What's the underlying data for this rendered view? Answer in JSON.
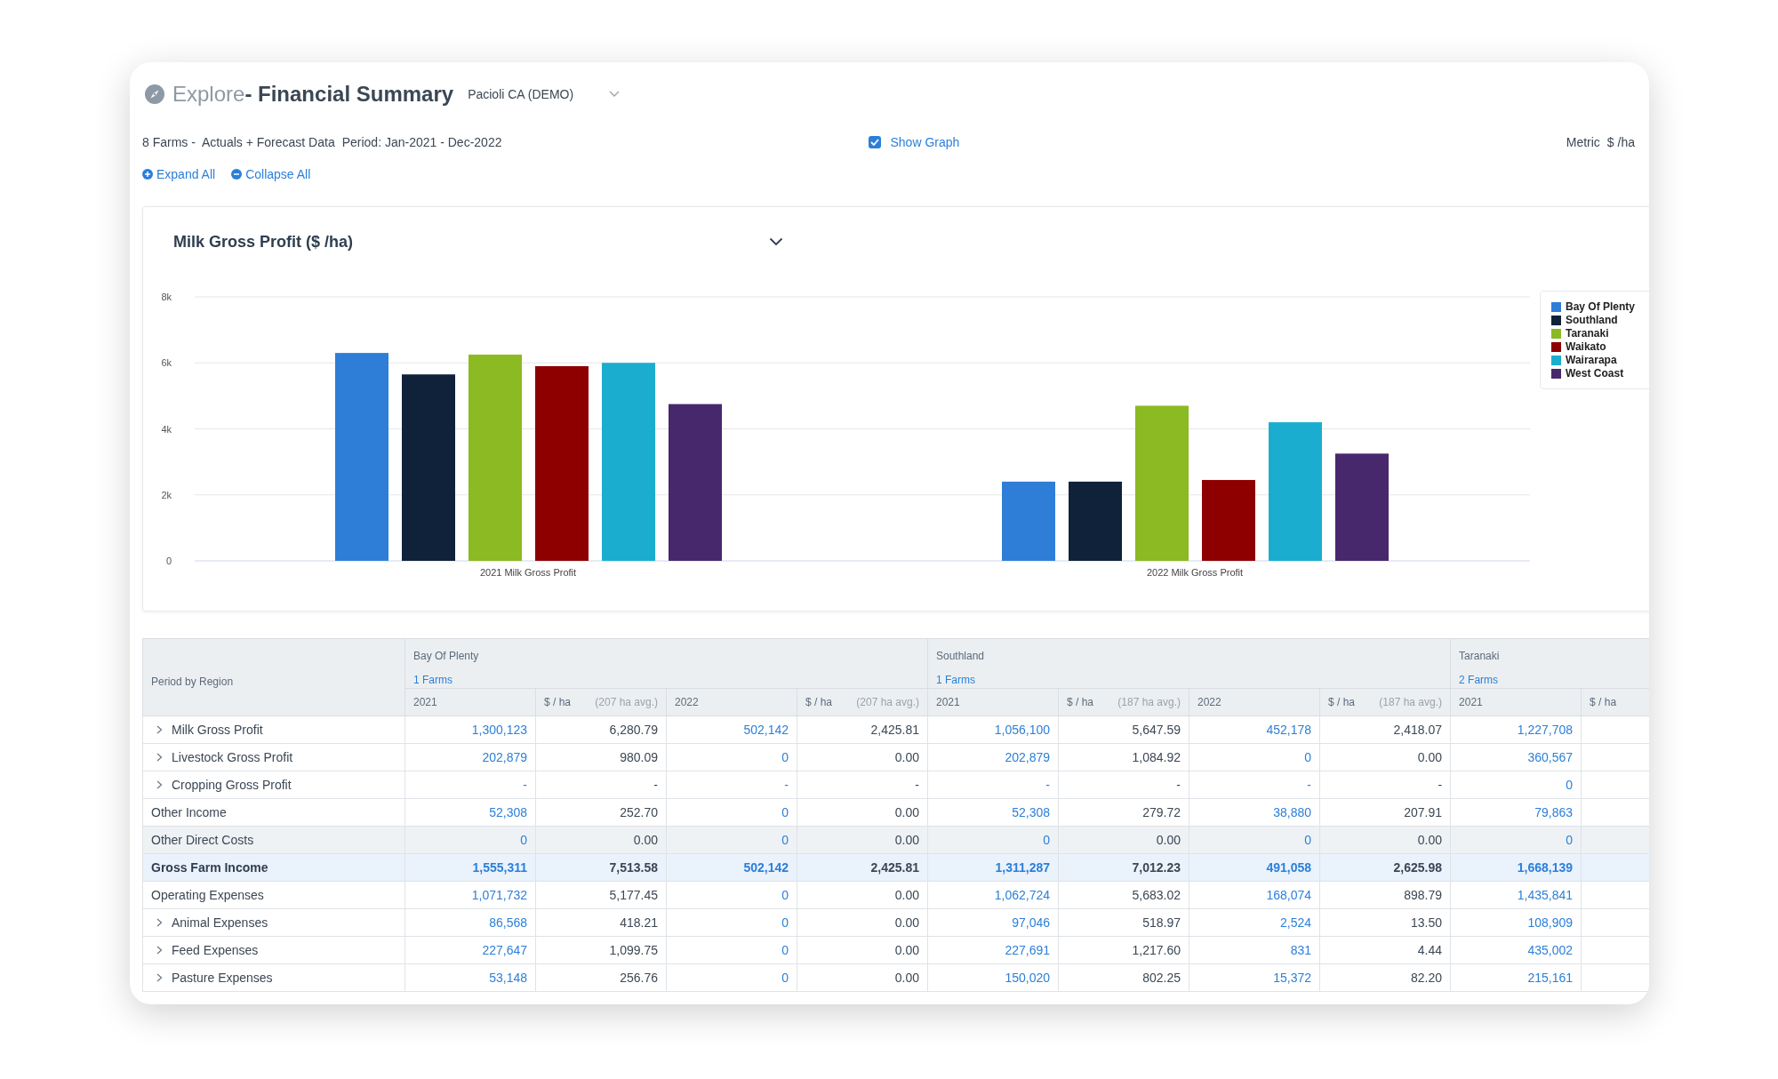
{
  "header": {
    "title_prefix": "Explore",
    "title": "- Financial Summary",
    "account": "Pacioli CA (DEMO)"
  },
  "info": {
    "summary": "8 Farms -  Actuals + Forecast Data",
    "period": "Period: Jan-2021 - Dec-2022",
    "show_graph": {
      "label": "Show Graph",
      "checked": true
    },
    "metric_label": "Metric",
    "metric_value": "$ /ha"
  },
  "actions": [
    "Expand All",
    "Collapse All"
  ],
  "chart_panel": {
    "title": "Milk Gross Profit ($ /ha)",
    "chart_data": {
      "type": "bar",
      "categories": [
        "2021 Milk Gross Profit",
        "2022 Milk Gross Profit"
      ],
      "series": [
        {
          "name": "Bay Of Plenty",
          "color": "#2e7ed8",
          "values": [
            6300,
            2400
          ]
        },
        {
          "name": "Southland",
          "color": "#0f223a",
          "values": [
            5650,
            2400
          ]
        },
        {
          "name": "Taranaki",
          "color": "#8bba22",
          "values": [
            6250,
            4700
          ]
        },
        {
          "name": "Waikato",
          "color": "#8e0000",
          "values": [
            5900,
            2450
          ]
        },
        {
          "name": "Wairarapa",
          "color": "#1badcf",
          "values": [
            6000,
            4200
          ]
        },
        {
          "name": "West Coast",
          "color": "#48286c",
          "values": [
            4750,
            3250
          ]
        }
      ],
      "grid": true,
      "ylim": [
        0,
        8000
      ],
      "yticks": [
        {
          "value": 0,
          "label": "0"
        },
        {
          "value": 2000,
          "label": "2k"
        },
        {
          "value": 4000,
          "label": "4k"
        },
        {
          "value": 6000,
          "label": "6k"
        },
        {
          "value": 8000,
          "label": "8k"
        }
      ]
    }
  },
  "table": {
    "corner": "Period by Region",
    "regions": [
      {
        "name": "Bay Of Plenty",
        "farms": "1 Farms",
        "columns": [
          {
            "label": "2021",
            "kind": "amount"
          },
          {
            "label": "$ / ha",
            "note": "(207 ha avg.)",
            "kind": "per_ha"
          },
          {
            "label": "2022",
            "kind": "amount"
          },
          {
            "label": "$ / ha",
            "note": "(207 ha avg.)",
            "kind": "per_ha"
          }
        ]
      },
      {
        "name": "Southland",
        "farms": "1 Farms",
        "columns": [
          {
            "label": "2021",
            "kind": "amount"
          },
          {
            "label": "$ / ha",
            "note": "(187 ha avg.)",
            "kind": "per_ha"
          },
          {
            "label": "2022",
            "kind": "amount"
          },
          {
            "label": "$ / ha",
            "note": "(187 ha avg.)",
            "kind": "per_ha"
          }
        ]
      },
      {
        "name": "Taranaki",
        "farms": "2 Farms",
        "columns": [
          {
            "label": "2021",
            "kind": "amount"
          },
          {
            "label": "$ / ha",
            "kind": "per_ha"
          }
        ]
      }
    ],
    "rows": [
      {
        "label": "Milk Gross Profit",
        "expandable": true,
        "kind": "line",
        "hovered": false,
        "values": [
          "1,300,123",
          "6,280.79",
          "502,142",
          "2,425.81",
          "1,056,100",
          "5,647.59",
          "452,178",
          "2,418.07",
          "1,227,708"
        ]
      },
      {
        "label": "Livestock Gross Profit",
        "expandable": true,
        "kind": "line",
        "hovered": false,
        "values": [
          "202,879",
          "980.09",
          "0",
          "0.00",
          "202,879",
          "1,084.92",
          "0",
          "0.00",
          "360,567"
        ]
      },
      {
        "label": "Cropping Gross Profit",
        "expandable": true,
        "kind": "line",
        "hovered": false,
        "values": [
          "-",
          "-",
          "-",
          "-",
          "-",
          "-",
          "-",
          "-",
          "0"
        ]
      },
      {
        "label": "Other Income",
        "expandable": false,
        "kind": "line",
        "hovered": false,
        "values": [
          "52,308",
          "252.70",
          "0",
          "0.00",
          "52,308",
          "279.72",
          "38,880",
          "207.91",
          "79,863"
        ]
      },
      {
        "label": "Other Direct Costs",
        "expandable": false,
        "kind": "line",
        "hovered": true,
        "values": [
          "0",
          "0.00",
          "0",
          "0.00",
          "0",
          "0.00",
          "0",
          "0.00",
          "0"
        ]
      },
      {
        "label": "Gross Farm Income",
        "expandable": false,
        "kind": "total",
        "hovered": false,
        "values": [
          "1,555,311",
          "7,513.58",
          "502,142",
          "2,425.81",
          "1,311,287",
          "7,012.23",
          "491,058",
          "2,625.98",
          "1,668,139"
        ]
      },
      {
        "label": "Operating Expenses",
        "expandable": false,
        "kind": "line",
        "hovered": false,
        "values": [
          "1,071,732",
          "5,177.45",
          "0",
          "0.00",
          "1,062,724",
          "5,683.02",
          "168,074",
          "898.79",
          "1,435,841"
        ]
      },
      {
        "label": "Animal Expenses",
        "expandable": true,
        "kind": "line",
        "hovered": false,
        "values": [
          "86,568",
          "418.21",
          "0",
          "0.00",
          "97,046",
          "518.97",
          "2,524",
          "13.50",
          "108,909"
        ]
      },
      {
        "label": "Feed Expenses",
        "expandable": true,
        "kind": "line",
        "hovered": false,
        "values": [
          "227,647",
          "1,099.75",
          "0",
          "0.00",
          "227,691",
          "1,217.60",
          "831",
          "4.44",
          "435,002"
        ]
      },
      {
        "label": "Pasture Expenses",
        "expandable": true,
        "kind": "line",
        "hovered": false,
        "values": [
          "53,148",
          "256.76",
          "0",
          "0.00",
          "150,020",
          "802.25",
          "15,372",
          "82.20",
          "215,161"
        ]
      }
    ]
  }
}
